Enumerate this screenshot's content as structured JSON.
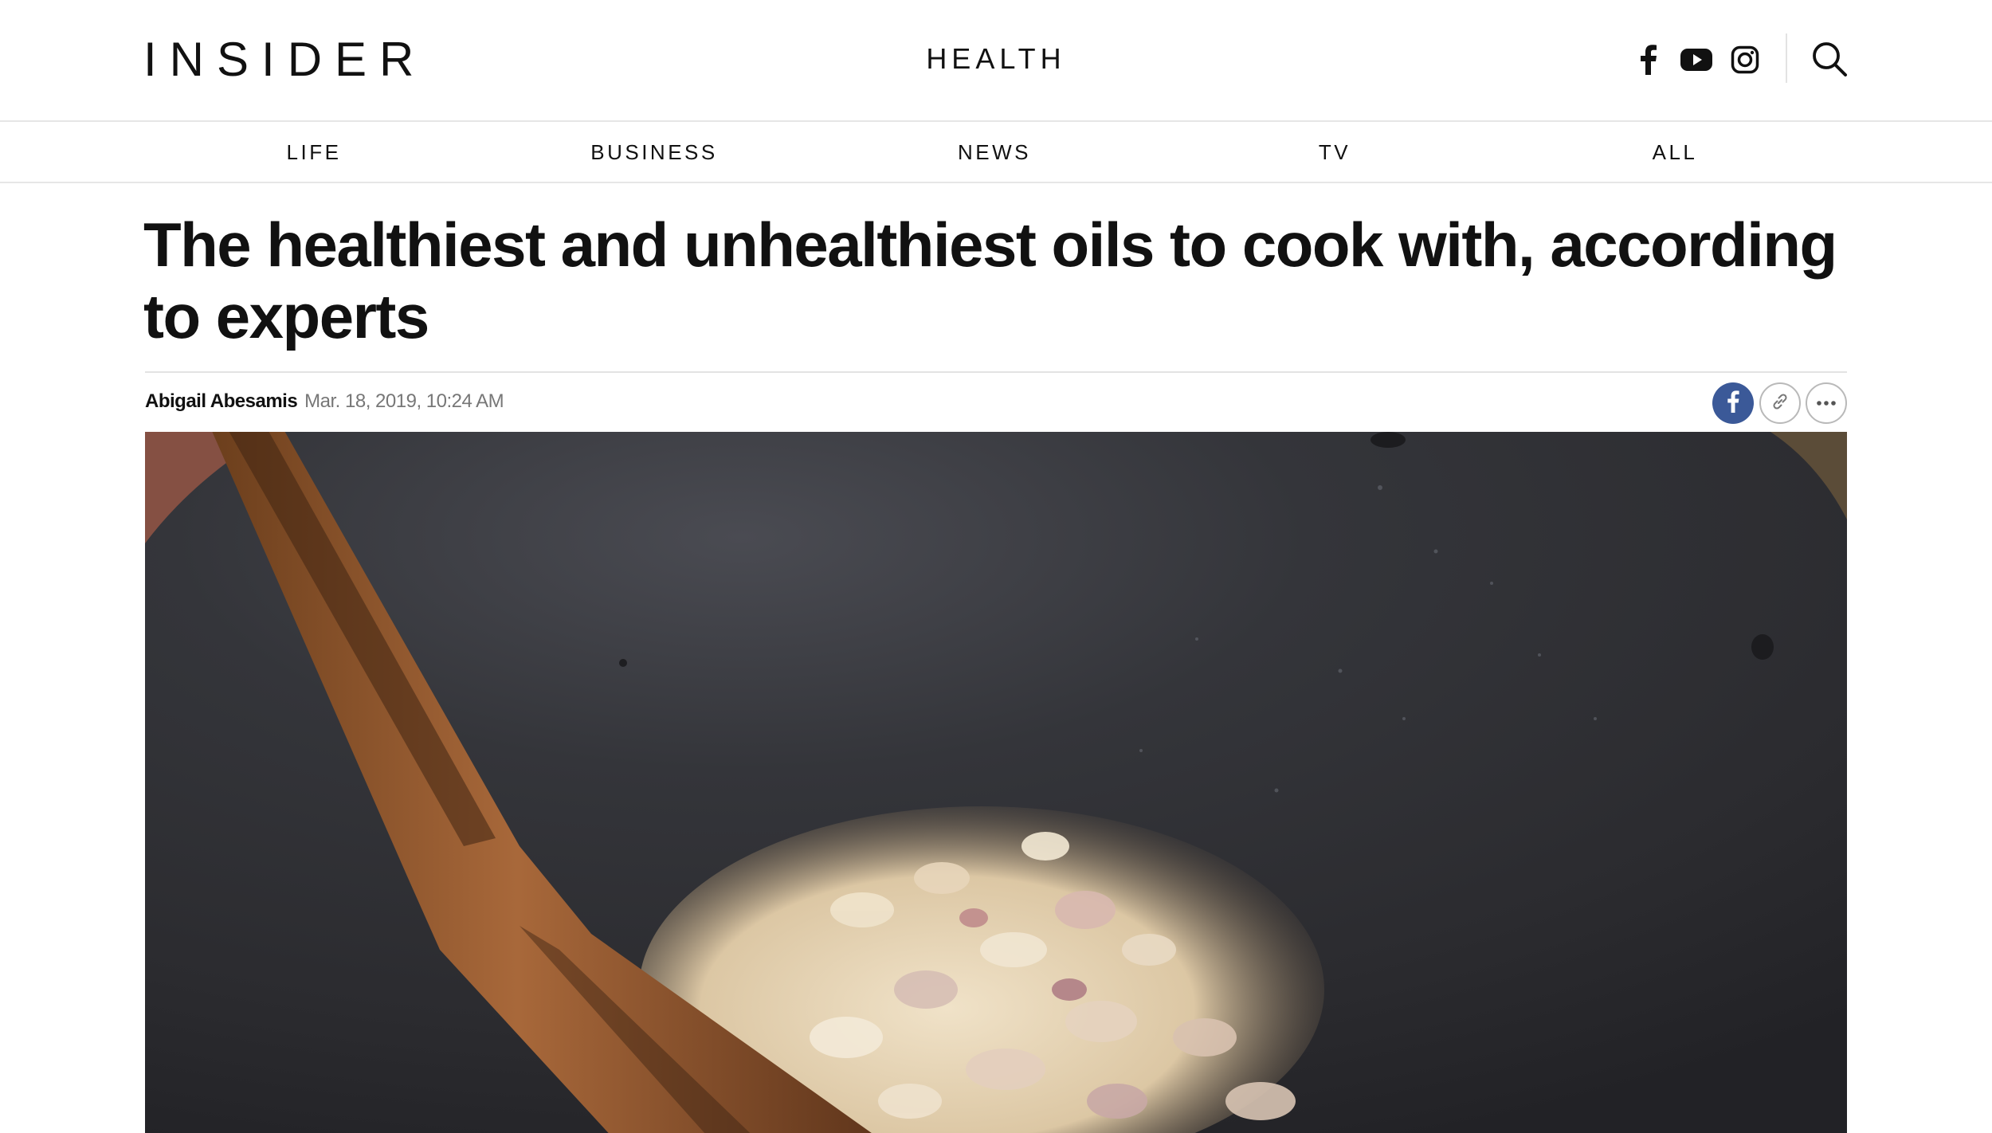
{
  "header": {
    "logo": "INSIDER",
    "section": "HEALTH",
    "social_icons": [
      "facebook-icon",
      "youtube-icon",
      "instagram-icon"
    ],
    "search_icon": "search-icon"
  },
  "nav": {
    "items": [
      {
        "label": "LIFE"
      },
      {
        "label": "BUSINESS"
      },
      {
        "label": "NEWS"
      },
      {
        "label": "TV"
      },
      {
        "label": "ALL"
      }
    ]
  },
  "article": {
    "headline": "The healthiest and unhealthiest oils to cook with, according to experts",
    "author": "Abigail Abesamis",
    "date": "Mar. 18, 2019, 10:24 AM",
    "share_icons": [
      "facebook-share-icon",
      "link-icon",
      "more-icon"
    ]
  },
  "colors": {
    "text": "#111111",
    "muted": "#777777",
    "facebook_blue": "#3b5998",
    "divider": "#e6e6e6"
  }
}
